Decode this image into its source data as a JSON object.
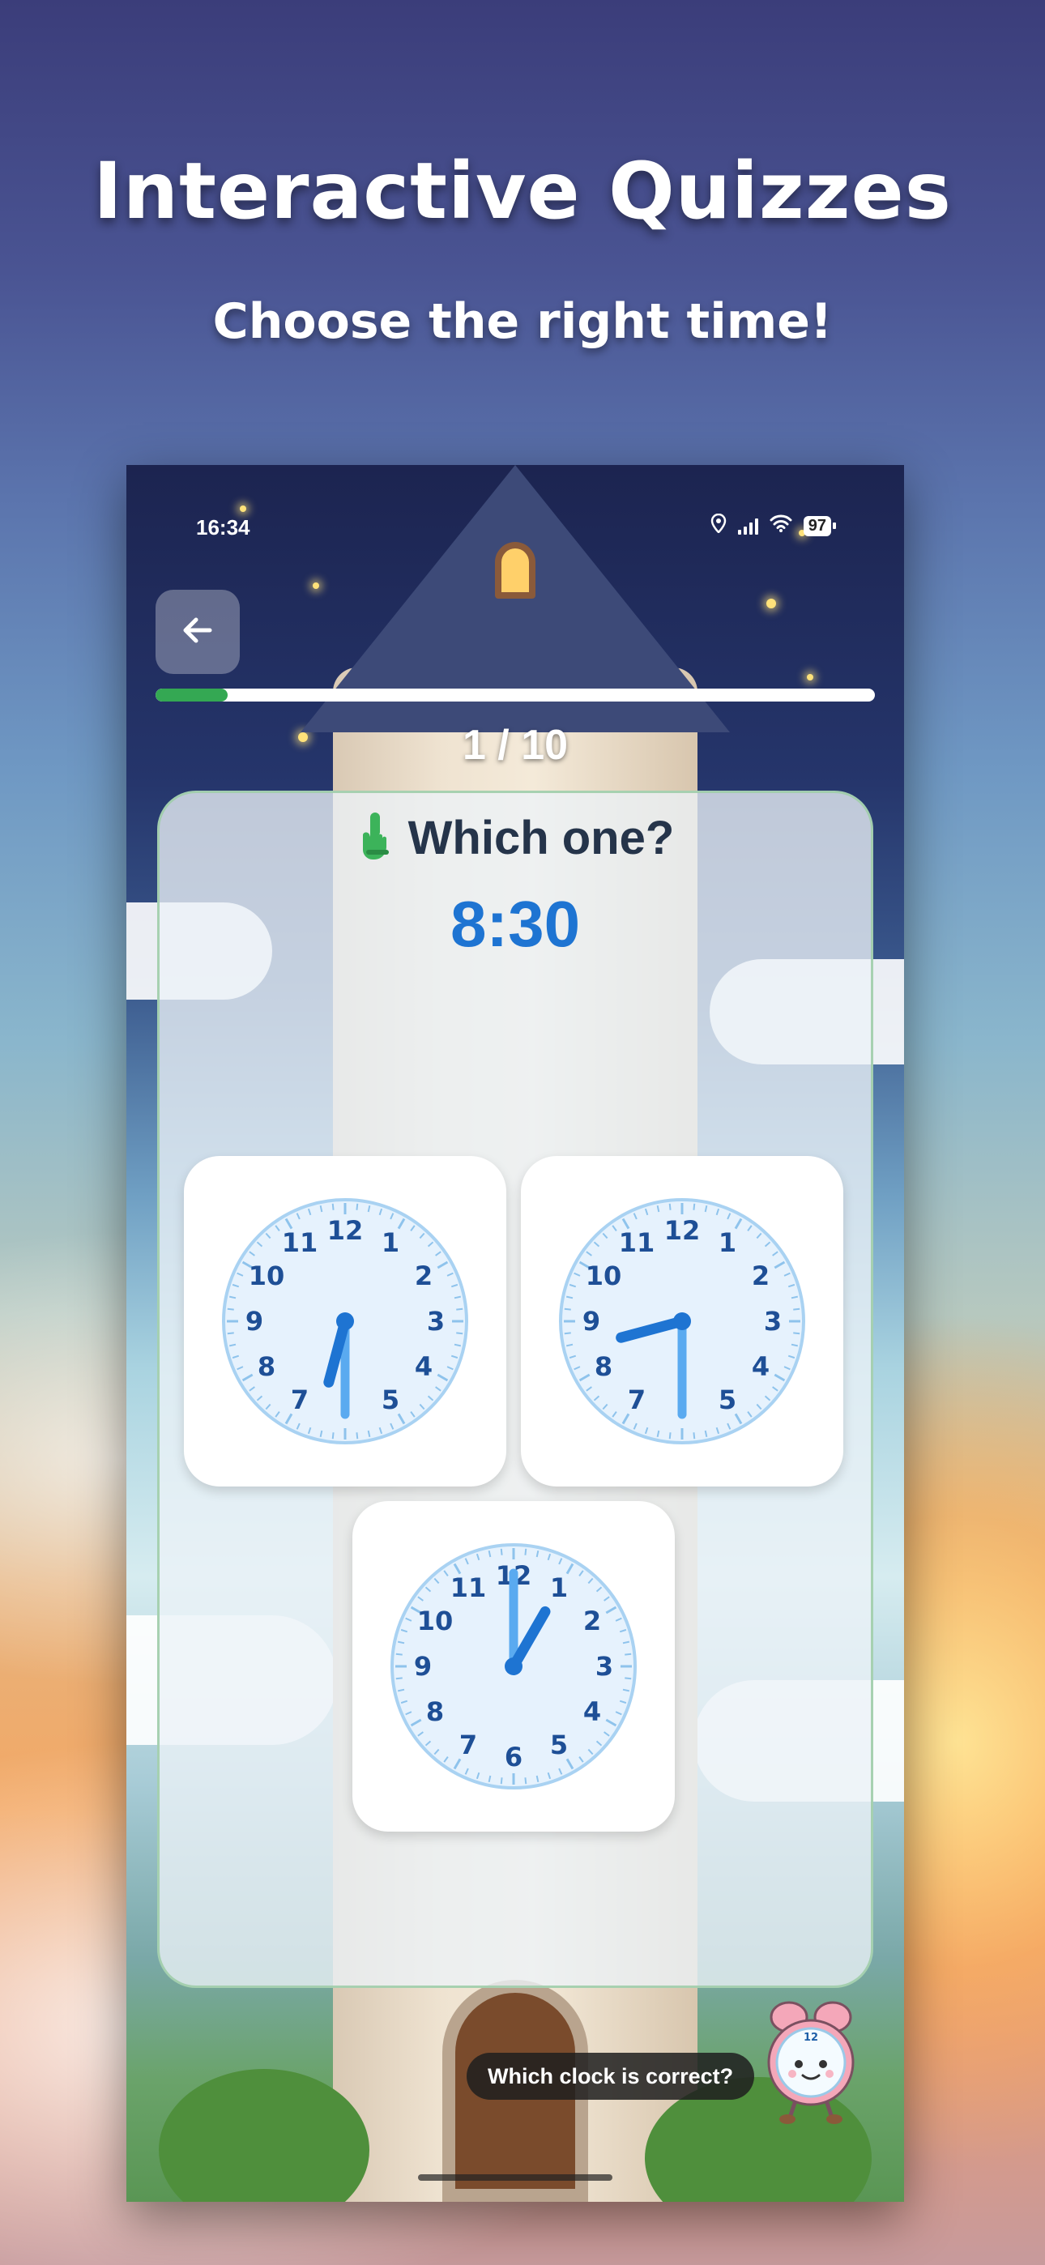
{
  "hero": {
    "title": "Interactive Quizzes",
    "subtitle": "Choose the right time!"
  },
  "status_bar": {
    "time": "16:34",
    "battery": "97",
    "icons": [
      "location-icon",
      "signal-icon",
      "wifi-icon",
      "battery-icon"
    ]
  },
  "quiz": {
    "progress_fraction": 0.1,
    "counter": "1 / 10",
    "question": "Which one?",
    "target_time": "8:30",
    "hint": "Which clock is correct?",
    "accent_color": "#1e74d2",
    "progress_color": "#34a853",
    "numbers": [
      "12",
      "1",
      "2",
      "3",
      "4",
      "5",
      "6",
      "7",
      "8",
      "9",
      "10",
      "11"
    ],
    "options": [
      {
        "hour": 6,
        "minute": 30,
        "show_six": false
      },
      {
        "hour": 8,
        "minute": 30,
        "show_six": false
      },
      {
        "hour": 1,
        "minute": 0,
        "show_six": true
      }
    ]
  }
}
